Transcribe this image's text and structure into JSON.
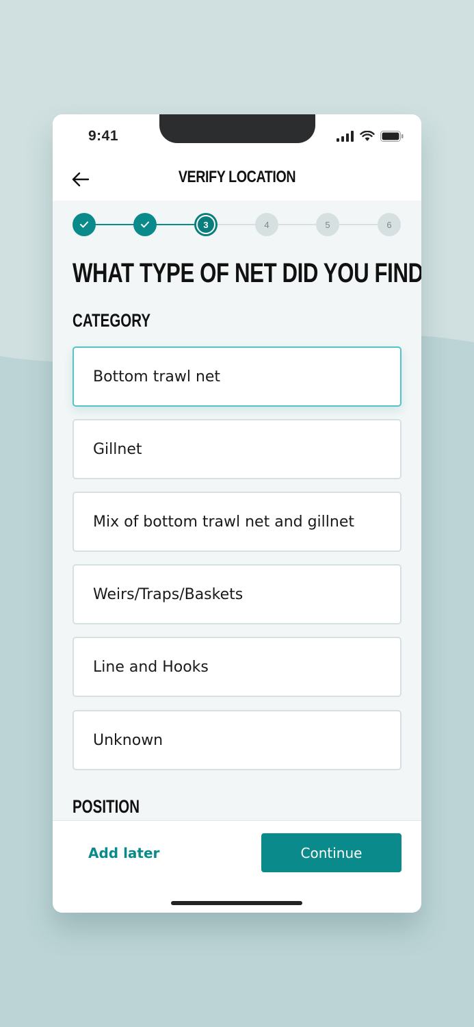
{
  "status_bar": {
    "time": "9:41"
  },
  "header": {
    "title": "VERIFY LOCATION",
    "back_icon": "arrow-left-icon"
  },
  "stepper": {
    "steps": [
      {
        "label": "1",
        "state": "done"
      },
      {
        "label": "2",
        "state": "done"
      },
      {
        "label": "3",
        "state": "current"
      },
      {
        "label": "4",
        "state": "todo"
      },
      {
        "label": "5",
        "state": "todo"
      },
      {
        "label": "6",
        "state": "todo"
      }
    ]
  },
  "question": "WHAT TYPE OF NET DID YOU FIND?",
  "category": {
    "label": "CATEGORY",
    "options": [
      {
        "label": "Bottom trawl net",
        "selected": true
      },
      {
        "label": "Gillnet",
        "selected": false
      },
      {
        "label": "Mix of bottom trawl net and gillnet",
        "selected": false
      },
      {
        "label": "Weirs/Traps/Baskets",
        "selected": false
      },
      {
        "label": "Line and Hooks",
        "selected": false
      },
      {
        "label": "Unknown",
        "selected": false
      }
    ]
  },
  "position": {
    "label": "POSITION"
  },
  "footer": {
    "add_later": "Add later",
    "continue": "Continue"
  },
  "colors": {
    "accent": "#0a8a8a",
    "selected_border": "#55c3c6",
    "background": "#d0e0e0",
    "pending_step": "#d6e0e0"
  }
}
